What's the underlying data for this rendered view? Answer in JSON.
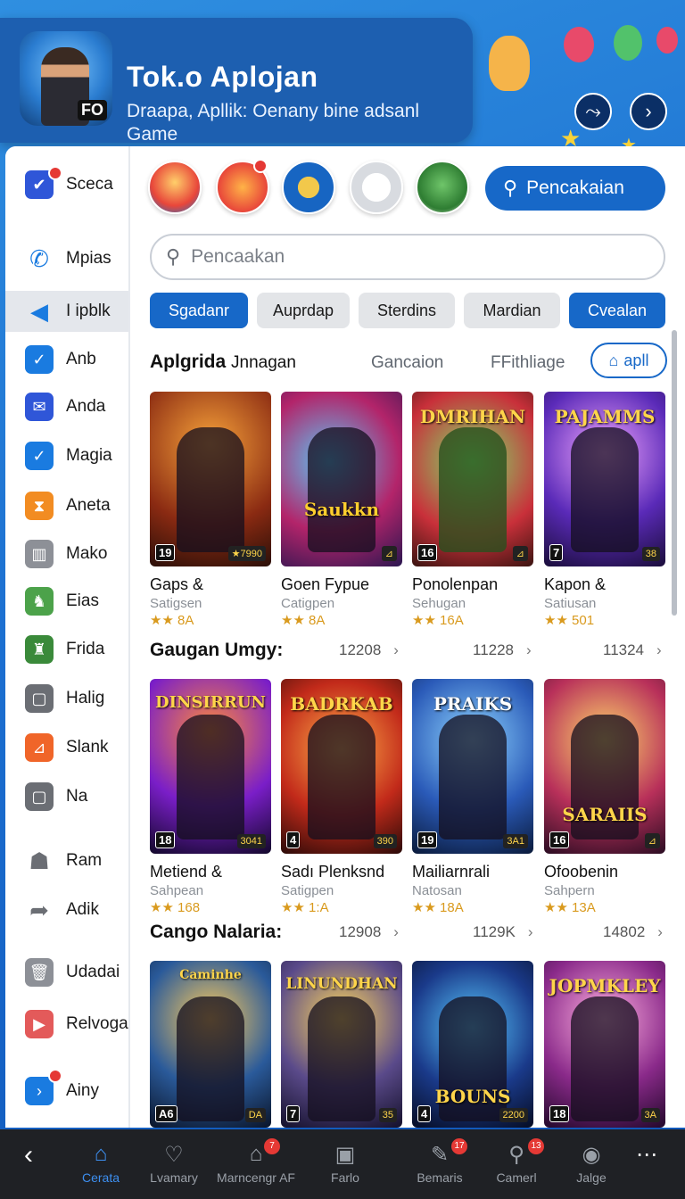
{
  "header": {
    "title": "Tok.o Aplojan",
    "subtitle": "Draapa, Apllik: Oenany bine adsanl Game",
    "icon_badge": "FO"
  },
  "sidebar": {
    "items": [
      {
        "label": "Sceca",
        "icon": "check-square-icon",
        "color": "#2f56d8",
        "badge": true
      },
      {
        "label": "Mpias",
        "icon": "phone-icon",
        "color": "#1a7be0"
      },
      {
        "label": "I ipblk",
        "icon": "shield-icon",
        "color": "#1a7be0",
        "active": true
      },
      {
        "label": "Anb",
        "icon": "check-icon",
        "color": "#1a7be0"
      },
      {
        "label": "Anda",
        "icon": "mail-icon",
        "color": "#2f56d8"
      },
      {
        "label": "Magia",
        "icon": "check-icon",
        "color": "#1a7be0"
      },
      {
        "label": "Aneta",
        "icon": "hourglass-icon",
        "color": "#f28c22"
      },
      {
        "label": "Mako",
        "icon": "grid-icon",
        "color": "#8d9097"
      },
      {
        "label": "Eias",
        "icon": "game-icon",
        "color": "#4ca24a"
      },
      {
        "label": "Frida",
        "icon": "game-icon",
        "color": "#3a8a3a"
      },
      {
        "label": "Halig",
        "icon": "square-icon",
        "color": "#6b6e74"
      },
      {
        "label": "Slank",
        "icon": "chart-icon",
        "color": "#f06529"
      },
      {
        "label": "Na",
        "icon": "square-icon",
        "color": "#6b6e74"
      },
      {
        "label": "Ram",
        "icon": "person-icon",
        "color": "#6b6e74"
      },
      {
        "label": "Adik",
        "icon": "share-icon",
        "color": "#6b6e74"
      },
      {
        "label": "Udadai",
        "icon": "trash-icon",
        "color": "#8d9097"
      },
      {
        "label": "Relvoga",
        "icon": "play-icon",
        "color": "#e35a5a"
      },
      {
        "label": "Ainy",
        "icon": "arrow-icon",
        "color": "#1a7be0",
        "badge": true
      }
    ]
  },
  "search": {
    "button_label": "Pencakaian",
    "placeholder": "Pencaakan"
  },
  "chips": [
    "Sgadanr",
    "Auprdap",
    "Sterdins",
    "Mardian",
    "Cvealan"
  ],
  "tabs": {
    "main": "Aplgrida",
    "secondary": "Jnnagan",
    "tab2": "Gancaion",
    "tab3": "FFithliage",
    "apl_button": "apll"
  },
  "sections": [
    {
      "title": null,
      "counts": [],
      "cards": [
        {
          "name": "Gaps &",
          "sub": "Satigsen",
          "rating": "★★ 8A",
          "art": "",
          "age": "19",
          "corner": "★7990"
        },
        {
          "name": "Goen Fypue",
          "sub": "Catigpen",
          "rating": "★★ 8A",
          "art": "Saukkn",
          "age": "",
          "corner": "⊿"
        },
        {
          "name": "Ponolenpan",
          "sub": "Sehugan",
          "rating": "★★ 16A",
          "art": "DMRIHAN",
          "age": "16",
          "corner": "⊿"
        },
        {
          "name": "Kapon &",
          "sub": "Satiusan",
          "rating": "★★ 501",
          "art": "PAJAMMS",
          "age": "7",
          "corner": "38"
        }
      ]
    },
    {
      "title": "Gaugan Umgy:",
      "counts": [
        "12208",
        "11228",
        "11324"
      ],
      "cards": [
        {
          "name": "Metiend &",
          "sub": "Sahpean",
          "rating": "★★ 168",
          "art": "DINSIRRUN",
          "age": "18",
          "corner": "3041"
        },
        {
          "name": "Sadı Plenksnd",
          "sub": "Satigpen",
          "rating": "★★ 1:A",
          "art": "BADRKAB",
          "age": "4",
          "corner": "390"
        },
        {
          "name": "Mailiarnrali",
          "sub": "Natosan",
          "rating": "★★ 18A",
          "art": "PRAIKS",
          "age": "19",
          "corner": "3A1"
        },
        {
          "name": "Ofoobenin",
          "sub": "Sahpern",
          "rating": "★★ 13A",
          "art": "SARAIIS",
          "age": "16",
          "corner": "⊿"
        }
      ]
    },
    {
      "title": "Cango Nalaria:",
      "counts": [
        "12908",
        "1129K",
        "14802"
      ],
      "cards": [
        {
          "name": "",
          "sub": "",
          "rating": "",
          "art": "Caminhe",
          "age": "A6",
          "corner": "DA"
        },
        {
          "name": "",
          "sub": "",
          "rating": "",
          "art": "LINUNDHAN",
          "age": "7",
          "corner": "35"
        },
        {
          "name": "",
          "sub": "",
          "rating": "",
          "art": "BOUNS",
          "age": "4",
          "corner": "2200"
        },
        {
          "name": "",
          "sub": "",
          "rating": "",
          "art": "JOPMKLEY",
          "age": "18",
          "corner": "3A"
        }
      ]
    }
  ],
  "bottom_nav": [
    {
      "label": "",
      "icon": "back-icon"
    },
    {
      "label": "Cerata",
      "icon": "home-icon",
      "active": true
    },
    {
      "label": "Lvamary",
      "icon": "heart-icon"
    },
    {
      "label": "Marncengr AF",
      "icon": "store-icon",
      "badge": "7"
    },
    {
      "label": "Farlo",
      "icon": "box-icon"
    },
    {
      "label": "Bemaris",
      "icon": "chat-icon",
      "badge": "17"
    },
    {
      "label": "Camerl",
      "icon": "search-icon",
      "badge": "13"
    },
    {
      "label": "Jalge",
      "icon": "avatar-icon"
    },
    {
      "label": "",
      "icon": "more-icon"
    }
  ],
  "colors": {
    "accent": "#1768c8",
    "background": "#1c6fd0",
    "bottom_bar": "#1f2125"
  }
}
